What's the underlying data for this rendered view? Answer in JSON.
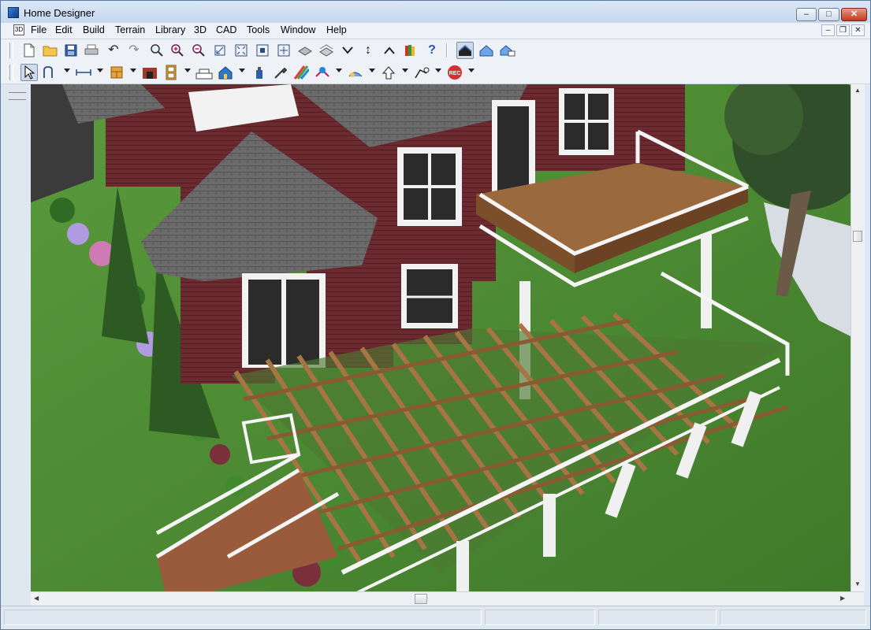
{
  "window": {
    "title": "Home Designer"
  },
  "menu": [
    "File",
    "Edit",
    "Build",
    "Terrain",
    "Library",
    "3D",
    "CAD",
    "Tools",
    "Window",
    "Help"
  ],
  "caption_buttons": {
    "minimize": "–",
    "maximize": "□",
    "close": "✕"
  },
  "mdi_buttons": {
    "minimize": "–",
    "restore": "❐",
    "close": "✕"
  },
  "toolbar2_record_label": "REC",
  "colors": {
    "grass": "#4f8a35",
    "siding": "#6a2a2f",
    "roof": "#5e5e5e",
    "deck_wood": "#9a6a3e",
    "trim": "#f4f4f4"
  }
}
